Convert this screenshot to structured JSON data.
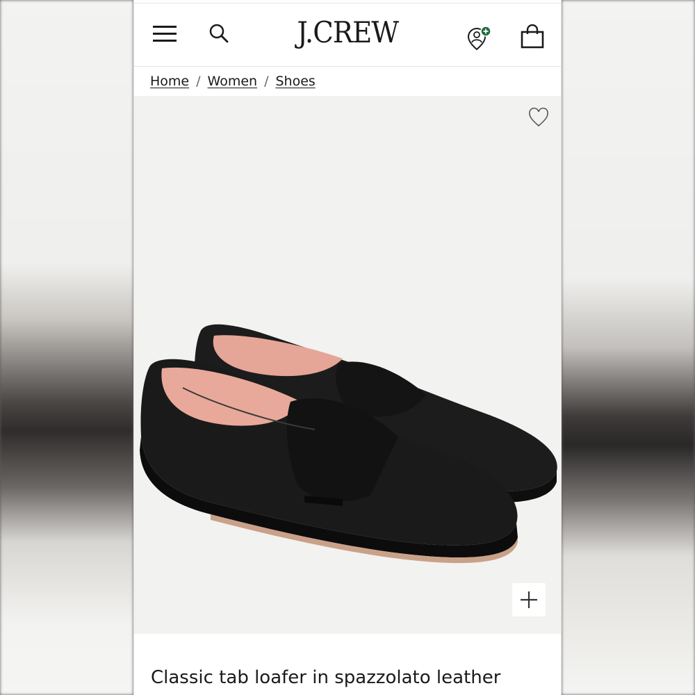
{
  "header": {
    "logo": "J.CREW",
    "menu_icon": "hamburger-menu-icon",
    "search_icon": "search-icon",
    "account_icon": "account-icon",
    "bag_icon": "shopping-bag-icon",
    "account_badge_color": "#1f6b3d"
  },
  "breadcrumb": {
    "items": [
      "Home",
      "Women",
      "Shoes"
    ],
    "separator": "/"
  },
  "product": {
    "title": "Classic tab loafer in spazzolato leather",
    "favorite_icon": "heart-icon",
    "zoom_icon": "plus-icon",
    "image_alt_color": "#1b1b1b",
    "lining_color": "#e8a99a"
  }
}
